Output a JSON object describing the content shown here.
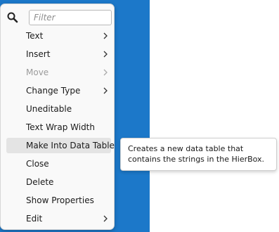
{
  "search": {
    "placeholder": "Filter",
    "value": ""
  },
  "menu": {
    "items": [
      {
        "label": "Text",
        "submenu": true,
        "disabled": false
      },
      {
        "label": "Insert",
        "submenu": true,
        "disabled": false
      },
      {
        "label": "Move",
        "submenu": true,
        "disabled": true
      },
      {
        "label": "Change Type",
        "submenu": true,
        "disabled": false
      },
      {
        "label": "Uneditable",
        "submenu": false,
        "disabled": false
      },
      {
        "label": "Text Wrap Width",
        "submenu": false,
        "disabled": false
      },
      {
        "label": "Make Into Data Table",
        "submenu": false,
        "disabled": false,
        "highlighted": true
      },
      {
        "label": "Close",
        "submenu": false,
        "disabled": false
      },
      {
        "label": "Delete",
        "submenu": false,
        "disabled": false
      },
      {
        "label": "Show Properties",
        "submenu": false,
        "disabled": false
      },
      {
        "label": "Edit",
        "submenu": true,
        "disabled": false
      }
    ]
  },
  "tooltip": {
    "text": "Creates a new data table that contains the strings in the HierBox."
  },
  "colors": {
    "background_panel": "#1c78c9",
    "menu_bg": "#f9f9f9",
    "highlight": "#e4e4e4",
    "disabled_text": "#9b9b9b"
  }
}
